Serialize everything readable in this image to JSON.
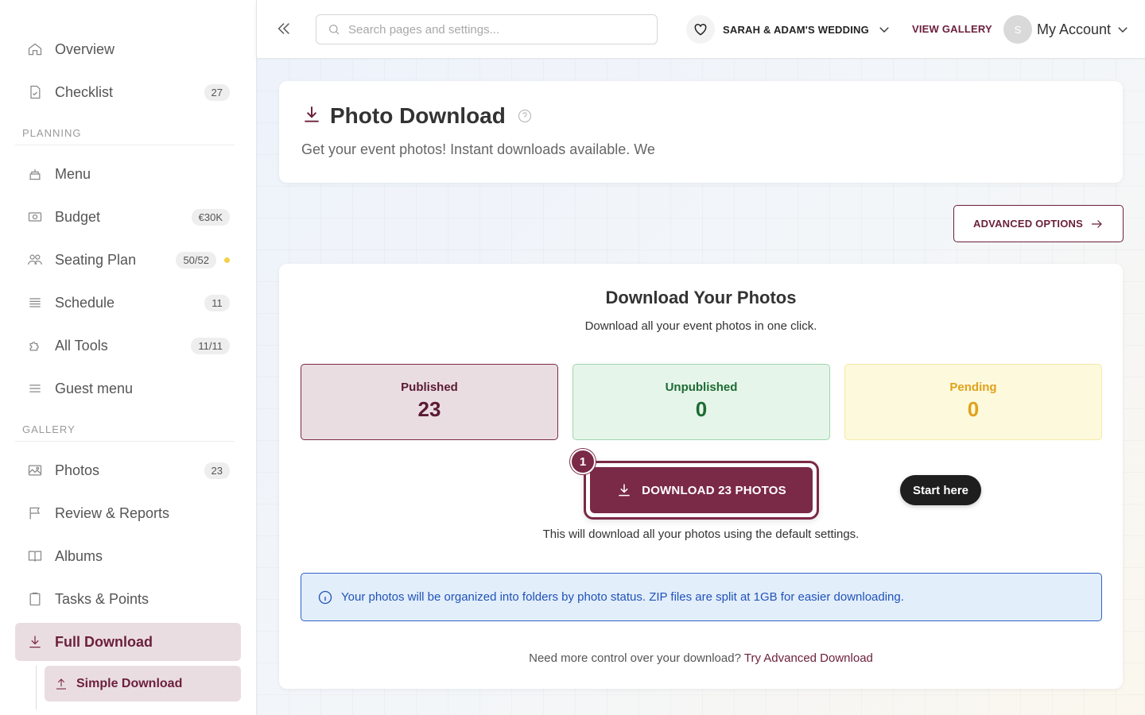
{
  "sidebar": {
    "items_top": [
      {
        "label": "Overview",
        "icon": "home-icon"
      },
      {
        "label": "Checklist",
        "icon": "checklist-icon",
        "badge": "27"
      }
    ],
    "planning_title": "PLANNING",
    "planning": [
      {
        "label": "Menu",
        "icon": "cake-icon"
      },
      {
        "label": "Budget",
        "icon": "money-icon",
        "badge": "€30K"
      },
      {
        "label": "Seating Plan",
        "icon": "people-icon",
        "badge": "50/52"
      },
      {
        "label": "Schedule",
        "icon": "list-icon",
        "badge": "11"
      },
      {
        "label": "All Tools",
        "icon": "puzzle-icon",
        "badge": "11/11"
      },
      {
        "label": "Guest menu",
        "icon": "menu-icon"
      }
    ],
    "gallery_title": "GALLERY",
    "gallery": [
      {
        "label": "Photos",
        "icon": "image-icon",
        "badge": "23"
      },
      {
        "label": "Review & Reports",
        "icon": "flag-icon"
      },
      {
        "label": "Albums",
        "icon": "book-icon"
      },
      {
        "label": "Tasks & Points",
        "icon": "clipboard-icon"
      },
      {
        "label": "Full Download",
        "icon": "download-icon"
      }
    ],
    "sub_item": {
      "label": "Simple Download",
      "icon": "upload-icon"
    }
  },
  "topbar": {
    "search_placeholder": "Search pages and settings...",
    "event_name": "SARAH & ADAM'S WEDDING",
    "view_gallery": "VIEW GALLERY",
    "avatar_initial": "S",
    "account_label": "My Account"
  },
  "header": {
    "title": "Photo Download",
    "subtitle": "Get your event photos! Instant downloads available. We"
  },
  "advanced_button": "ADVANCED OPTIONS",
  "download": {
    "title": "Download Your Photos",
    "subtitle": "Download all your event photos in one click.",
    "stats": {
      "published": {
        "label": "Published",
        "value": "23"
      },
      "unpublished": {
        "label": "Unpublished",
        "value": "0"
      },
      "pending": {
        "label": "Pending",
        "value": "0"
      }
    },
    "step_number": "1",
    "button_label": "DOWNLOAD 23 PHOTOS",
    "start_here": "Start here",
    "note": "This will download all your photos using the default settings.",
    "info": "Your photos will be organized into folders by photo status. ZIP files are split at 1GB for easier downloading.",
    "more_text": "Need more control over your download?",
    "more_link": "Try Advanced Download"
  },
  "colors": {
    "brand": "#7a2946",
    "info_blue": "#2053b8",
    "pending_yellow": "#e0a21c",
    "unpublished_green": "#1e6b33"
  }
}
